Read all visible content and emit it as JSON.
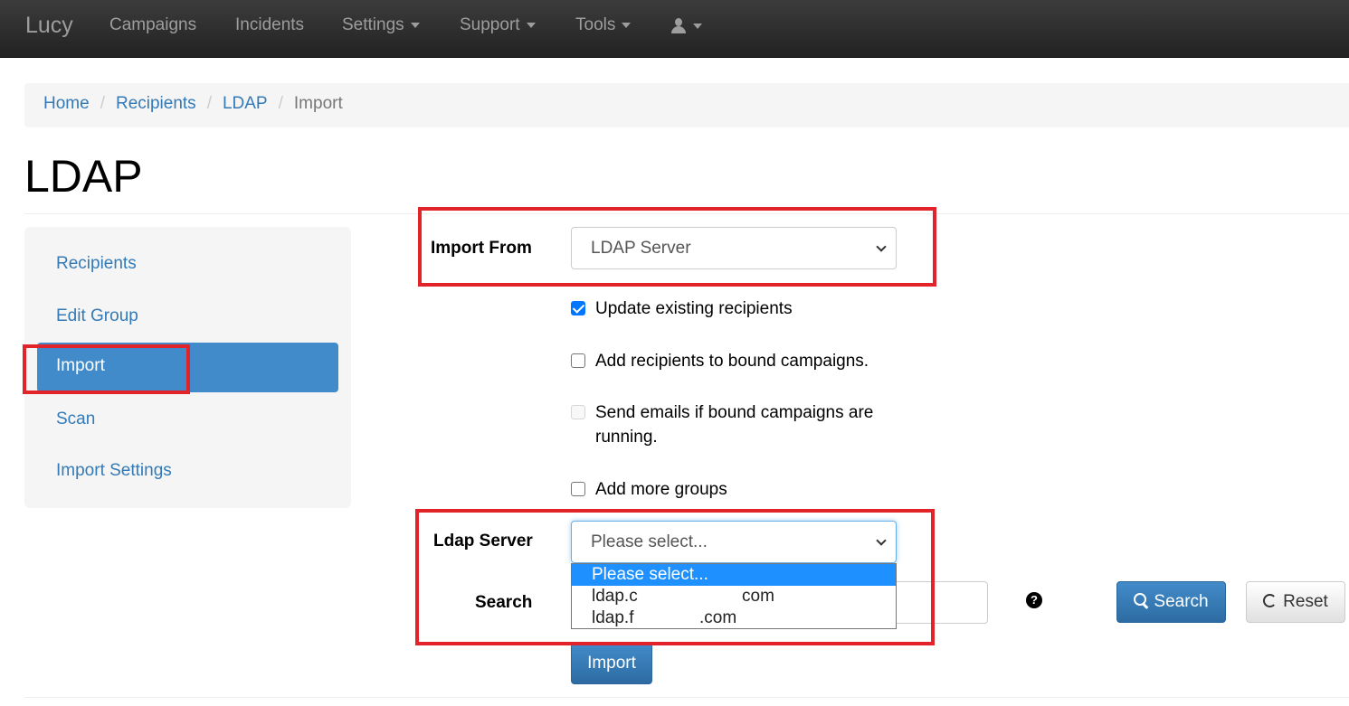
{
  "navbar": {
    "brand": "Lucy",
    "items": [
      {
        "label": "Campaigns"
      },
      {
        "label": "Incidents"
      },
      {
        "label": "Settings"
      },
      {
        "label": "Support"
      },
      {
        "label": "Tools"
      }
    ],
    "user_icon": "user-icon"
  },
  "breadcrumb": {
    "items": [
      "Home",
      "Recipients",
      "LDAP"
    ],
    "active": "Import",
    "separator": "/"
  },
  "page_title": "LDAP",
  "sidebar": {
    "items": [
      {
        "label": "Recipients"
      },
      {
        "label": "Edit Group"
      },
      {
        "label": "Import",
        "active": true
      },
      {
        "label": "Scan"
      },
      {
        "label": "Import Settings"
      }
    ]
  },
  "form": {
    "import_from": {
      "label": "Import From",
      "value": "LDAP Server"
    },
    "checkboxes": [
      {
        "label": "Update existing recipients",
        "checked": true,
        "disabled": false
      },
      {
        "label": "Add recipients to bound campaigns.",
        "checked": false,
        "disabled": false
      },
      {
        "label": "Send emails if bound campaigns are running.",
        "checked": false,
        "disabled": true
      },
      {
        "label": "Add more groups",
        "checked": false,
        "disabled": false
      }
    ],
    "ldap_server": {
      "label": "Ldap Server",
      "value": "Please select...",
      "options": [
        {
          "text": "Please select...",
          "selected": true
        },
        {
          "text_visible_start": "ldap.c",
          "text_visible_end": "com"
        },
        {
          "text_visible_start": "ldap.f",
          "text_visible_end": ".com"
        }
      ]
    },
    "search": {
      "label": "Search",
      "help_icon": "question-icon"
    },
    "search_button": {
      "label": "Search",
      "icon": "search-icon"
    },
    "reset_button": {
      "label": "Reset",
      "icon": "refresh-icon"
    },
    "import_button": {
      "label": "Import"
    }
  },
  "colors": {
    "navbar_bg": "#222222",
    "link": "#337ab7",
    "active_nav": "#428bca",
    "highlight": "#e2232a",
    "checkbox_checked": "#0075ff",
    "option_selected": "#1e90ff"
  }
}
